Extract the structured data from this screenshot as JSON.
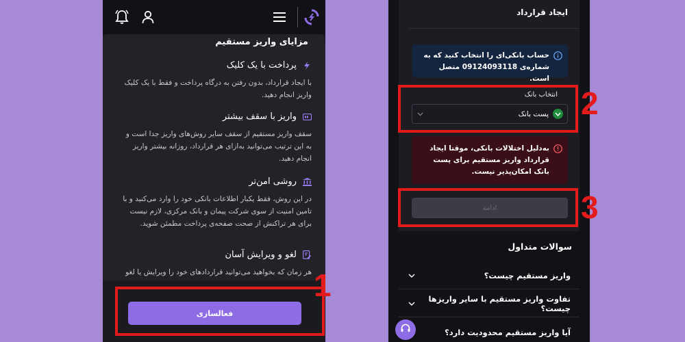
{
  "left": {
    "advantages_title": "مزایای واریز مستقیم",
    "features": [
      {
        "icon": "lightning-icon",
        "title": "پرداخت با یک کلیک",
        "text": "با ایجاد قرارداد، بدون رفتن به درگاه پرداخت و فقط با یک کلیک واریز انجام دهید."
      },
      {
        "icon": "card-limit-icon",
        "title": "واریز با سقف بیشتر",
        "text": "سقف واریز مستقیم از سقف سایر روش‌های واریز جدا است و به این ترتیب می‌توانید به‌ازای هر قرارداد، روزانه بیشتر واریز انجام دهید."
      },
      {
        "icon": "bank-icon",
        "title": "روشی امن‌تر",
        "text": "در این روش، فقط یکبار اطلاعات بانکی خود را وارد می‌کنید و با تامین امنیت از سوی شرکت پیمان و بانک مرکزی، لازم نیست برای هر تراکنش از صحت صفحه‌ی پرداخت مطمئن شوید."
      },
      {
        "icon": "edit-document-icon",
        "title": "لغو و ویرایش آسان",
        "text": "هر زمان که بخواهید می‌توانید قراردادهای خود را ویرایش یا لغو کنید."
      }
    ],
    "activate_label": "فعالسازی"
  },
  "right": {
    "panel_title": "ایجاد قرارداد",
    "info_text": "حساب بانکی‌ای را انتخاب کنید که به شماره‌ی 09124093118 متصل است.",
    "bank_label": "انتخاب بانک",
    "selected_bank": "پست بانک",
    "error_text": "به‌دلیل اختلالات بانکی، موقتا ایجاد قرارداد واریز مستقیم برای پست بانک امکان‌پذیر نیست.",
    "continue_label": "ادامه",
    "faq_title": "سوالات متداول",
    "faq": [
      "واریز مستقیم چیست؟",
      "تفاوت واریز مستقیم با سایر واریزها چیست؟",
      "آیا واریز مستقیم محدودیت دارد؟"
    ]
  },
  "annotations": {
    "n1": "1",
    "n2": "2",
    "n3": "3"
  },
  "colors": {
    "accent": "#8e6ce6",
    "highlight": "#e31b1b",
    "background": "#a78ad6"
  }
}
